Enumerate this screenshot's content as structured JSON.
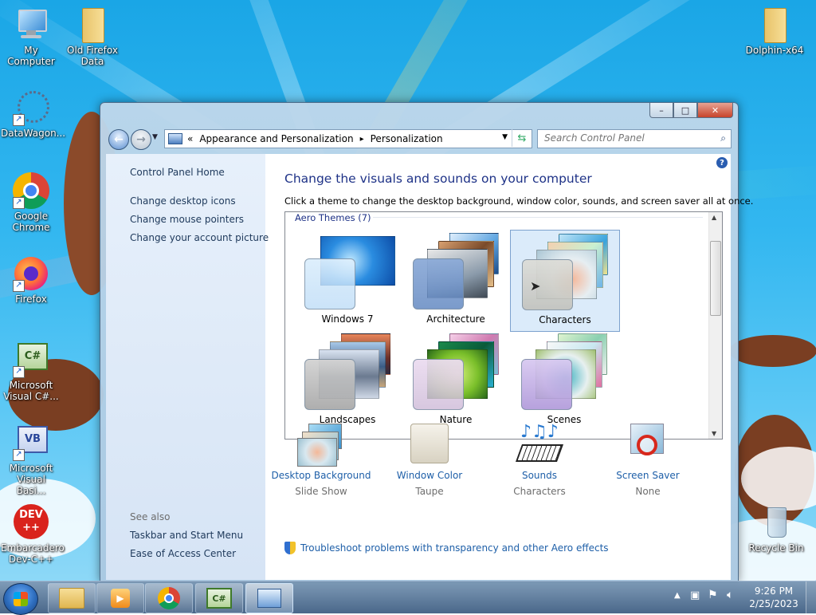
{
  "desktop": {
    "icons": [
      {
        "label": "My Computer"
      },
      {
        "label": "Old Firefox Data"
      },
      {
        "label": "Dolphin-x64"
      },
      {
        "label": "DataWagon..."
      },
      {
        "label": "Google Chrome"
      },
      {
        "label": "Firefox"
      },
      {
        "label": "Microsoft Visual C#..."
      },
      {
        "label": "Microsoft Visual Basi..."
      },
      {
        "label": "Embarcadero Dev-C++"
      },
      {
        "label": "Recycle Bin"
      }
    ]
  },
  "window": {
    "controls": {
      "minimize": "–",
      "maximize": "□",
      "close": "✕"
    },
    "address": {
      "prefix": "«",
      "segments": [
        "Appearance and Personalization",
        "Personalization"
      ],
      "separator": "▸"
    },
    "search": {
      "placeholder": "Search Control Panel"
    },
    "left_pane": {
      "home": "Control Panel Home",
      "links": [
        "Change desktop icons",
        "Change mouse pointers",
        "Change your account picture"
      ],
      "see_also_label": "See also",
      "see_also": [
        "Taskbar and Start Menu",
        "Ease of Access Center"
      ]
    },
    "main": {
      "heading": "Change the visuals and sounds on your computer",
      "subheading": "Click a theme to change the desktop background, window color, sounds, and screen saver all at once.",
      "group_label": "Aero Themes (7)",
      "themes": [
        {
          "name": "Windows 7",
          "selected": false
        },
        {
          "name": "Architecture",
          "selected": false
        },
        {
          "name": "Characters",
          "selected": true
        },
        {
          "name": "Landscapes",
          "selected": false
        },
        {
          "name": "Nature",
          "selected": false
        },
        {
          "name": "Scenes",
          "selected": false
        }
      ],
      "options": [
        {
          "title": "Desktop Background",
          "value": "Slide Show"
        },
        {
          "title": "Window Color",
          "value": "Taupe"
        },
        {
          "title": "Sounds",
          "value": "Characters"
        },
        {
          "title": "Screen Saver",
          "value": "None"
        }
      ],
      "troubleshoot": "Troubleshoot problems with transparency and other Aero effects"
    }
  },
  "taskbar": {
    "clock_time": "9:26 PM",
    "clock_date": "2/25/2023",
    "csharp_badge": "C#",
    "vb_badge": "VB",
    "dev_badge": "DEV\n++"
  },
  "colors": {
    "link": "#1e5fa8",
    "heading": "#1e3287",
    "left_pane_link": "#1e395b",
    "selection": "#c3def7"
  }
}
